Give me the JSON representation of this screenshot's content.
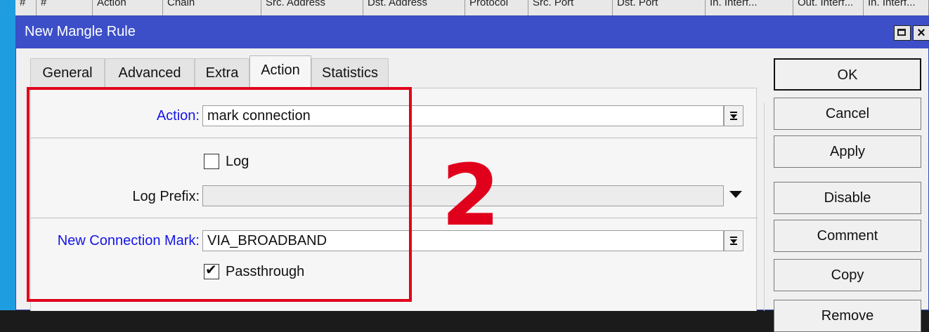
{
  "background_header": {
    "columns": [
      "#",
      "Action",
      "Chain",
      "Src. Address",
      "Dst. Address",
      "Protocol",
      "Src. Port",
      "Dst. Port",
      "In. Interf...",
      "Out. Interf...",
      "In. Interf..."
    ]
  },
  "window": {
    "title": "New Mangle Rule",
    "maximize_icon": "maximize-icon",
    "close_label": "×"
  },
  "tabs": [
    {
      "label": "General",
      "active": false
    },
    {
      "label": "Advanced",
      "active": false
    },
    {
      "label": "Extra",
      "active": false
    },
    {
      "label": "Action",
      "active": true
    },
    {
      "label": "Statistics",
      "active": false
    }
  ],
  "form": {
    "action": {
      "label": "Action:",
      "value": "mark connection"
    },
    "log": {
      "label": "Log",
      "checked": false
    },
    "log_prefix": {
      "label": "Log Prefix:",
      "value": ""
    },
    "new_connection_mark": {
      "label": "New Connection Mark:",
      "value": "VIA_BROADBAND"
    },
    "passthrough": {
      "label": "Passthrough",
      "checked": true
    }
  },
  "buttons": {
    "ok": "OK",
    "cancel": "Cancel",
    "apply": "Apply",
    "disable": "Disable",
    "comment": "Comment",
    "copy": "Copy",
    "remove": "Remove"
  },
  "annotation": {
    "step_number": "2",
    "color": "#e1001b"
  },
  "colors": {
    "titlebar": "#3c4fc9",
    "label_blue": "#1515e8",
    "frame": "#1f9de1"
  }
}
